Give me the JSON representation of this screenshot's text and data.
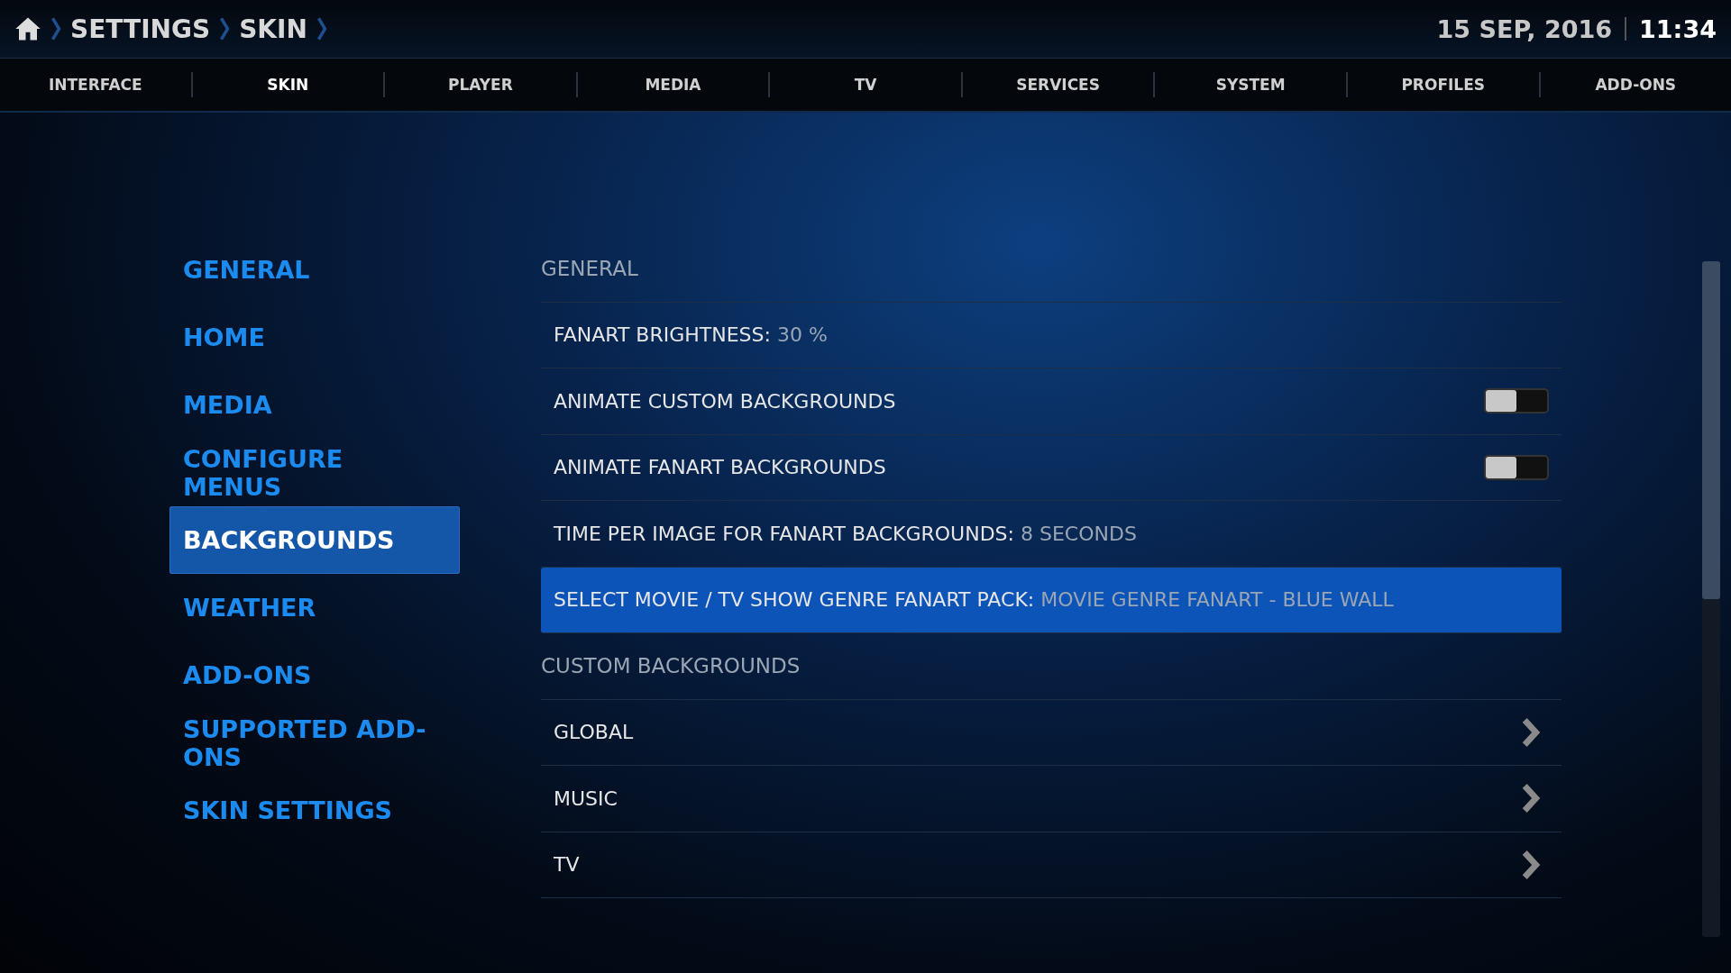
{
  "breadcrumb": [
    "SETTINGS",
    "SKIN"
  ],
  "date": "15 SEP, 2016",
  "time": "11:34",
  "tabs": [
    {
      "label": "INTERFACE",
      "selected": false
    },
    {
      "label": "SKIN",
      "selected": true
    },
    {
      "label": "PLAYER",
      "selected": false
    },
    {
      "label": "MEDIA",
      "selected": false
    },
    {
      "label": "TV",
      "selected": false
    },
    {
      "label": "SERVICES",
      "selected": false
    },
    {
      "label": "SYSTEM",
      "selected": false
    },
    {
      "label": "PROFILES",
      "selected": false
    },
    {
      "label": "ADD-ONS",
      "selected": false
    }
  ],
  "categories": [
    {
      "label": "GENERAL",
      "selected": false
    },
    {
      "label": "HOME",
      "selected": false
    },
    {
      "label": "MEDIA",
      "selected": false
    },
    {
      "label": "CONFIGURE MENUS",
      "selected": false
    },
    {
      "label": "BACKGROUNDS",
      "selected": true
    },
    {
      "label": "WEATHER",
      "selected": false
    },
    {
      "label": "ADD-ONS",
      "selected": false
    },
    {
      "label": "SUPPORTED ADD-ONS",
      "selected": false
    },
    {
      "label": "SKIN SETTINGS",
      "selected": false
    }
  ],
  "settings": [
    {
      "kind": "header",
      "label": "GENERAL"
    },
    {
      "kind": "value",
      "label": "FANART BRIGHTNESS:",
      "value": "30 %",
      "selected": false
    },
    {
      "kind": "toggle",
      "label": "ANIMATE CUSTOM BACKGROUNDS",
      "on": false,
      "selected": false
    },
    {
      "kind": "toggle",
      "label": "ANIMATE FANART BACKGROUNDS",
      "on": false,
      "selected": false
    },
    {
      "kind": "value",
      "label": "TIME PER IMAGE FOR FANART BACKGROUNDS:",
      "value": "8 SECONDS",
      "selected": false
    },
    {
      "kind": "value",
      "label": "SELECT MOVIE / TV SHOW GENRE FANART PACK:",
      "value": "MOVIE GENRE FANART - BLUE WALL",
      "selected": true
    },
    {
      "kind": "header",
      "label": "CUSTOM BACKGROUNDS"
    },
    {
      "kind": "link",
      "label": "GLOBAL",
      "selected": false
    },
    {
      "kind": "link",
      "label": "MUSIC",
      "selected": false
    },
    {
      "kind": "link",
      "label": "TV",
      "selected": false
    }
  ]
}
